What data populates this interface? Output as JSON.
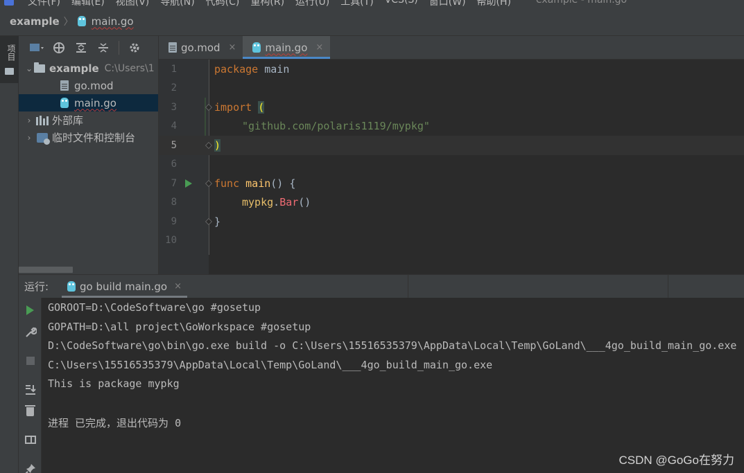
{
  "menubar": {
    "items": [
      "文件(F)",
      "编辑(E)",
      "视图(V)",
      "导航(N)",
      "代码(C)",
      "重构(R)",
      "运行(U)",
      "工具(T)",
      "VCS(S)",
      "窗口(W)",
      "帮助(H)"
    ],
    "window_title": "example - main.go"
  },
  "navbar": {
    "project": "example",
    "separator": "〉",
    "file": "main.go"
  },
  "left_strip": {
    "project_tab": "项目"
  },
  "project_tree": {
    "items": [
      {
        "label": "example",
        "path": "C:\\Users\\1",
        "arrow": "⌄"
      },
      {
        "label": "go.mod"
      },
      {
        "label": "main.go"
      },
      {
        "label": "外部库",
        "arrow": "›"
      },
      {
        "label": "临时文件和控制台",
        "arrow": "›"
      }
    ]
  },
  "editor": {
    "tabs": [
      {
        "label": "go.mod",
        "close": "×"
      },
      {
        "label": "main.go",
        "close": "×"
      }
    ],
    "line_numbers": [
      "1",
      "2",
      "3",
      "4",
      "5",
      "6",
      "7",
      "8",
      "9",
      "10"
    ],
    "code": {
      "l1_kw": "package",
      "l1_rest": " main",
      "l3_kw": "import",
      "l3_paren": "(",
      "l4_str": "\"github.com/polaris1119/mypkg\"",
      "l5_paren": ")",
      "l7_kw": "func",
      "l7_fn": "main",
      "l7_rest": "() {",
      "l8_pkg": "mypkg",
      "l8_dot": ".",
      "l8_fn": "Bar",
      "l8_rest": "()",
      "l9": "}"
    }
  },
  "run_panel": {
    "label": "运行:",
    "tab_label": "go build main.go",
    "tab_close": "×",
    "console_lines": [
      "GOROOT=D:\\CodeSoftware\\go #gosetup",
      "GOPATH=D:\\all project\\GoWorkspace #gosetup",
      "D:\\CodeSoftware\\go\\bin\\go.exe build -o C:\\Users\\15516535379\\AppData\\Local\\Temp\\GoLand\\___4go_build_main_go.exe",
      "C:\\Users\\15516535379\\AppData\\Local\\Temp\\GoLand\\___4go_build_main_go.exe",
      "This is package mypkg",
      "",
      "进程 已完成，退出代码为 0"
    ]
  },
  "watermark": "CSDN @GoGo在努力",
  "colors": {
    "keyword": "#cc7832",
    "function": "#ffc66d",
    "string": "#6a8759",
    "run_green": "#499c54",
    "selection": "#0d293e"
  }
}
